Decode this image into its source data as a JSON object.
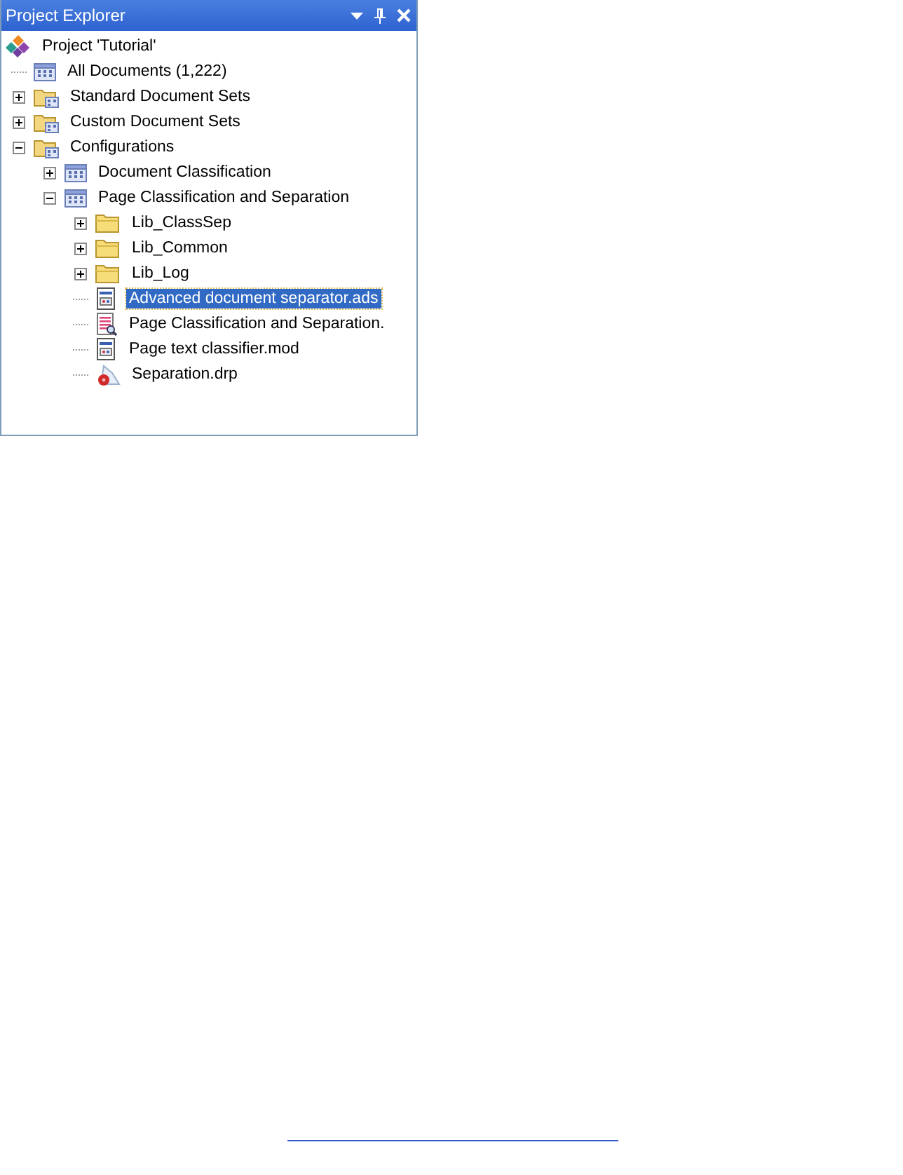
{
  "panel": {
    "title": "Project Explorer"
  },
  "tree": [
    {
      "label": "Project 'Tutorial'",
      "kind": "project",
      "selected": false,
      "children": [
        {
          "label": "All Documents  (1,222)",
          "kind": "docset",
          "selected": false
        },
        {
          "label": "Standard Document Sets",
          "kind": "folderset",
          "expanded": false,
          "selected": false
        },
        {
          "label": "Custom Document Sets",
          "kind": "folderset",
          "expanded": false,
          "selected": false
        },
        {
          "label": "Configurations",
          "kind": "folderset",
          "expanded": true,
          "selected": false,
          "children": [
            {
              "label": "Document Classification",
              "kind": "docset",
              "expanded": false,
              "selected": false
            },
            {
              "label": "Page Classification and Separation",
              "kind": "docset",
              "expanded": true,
              "selected": false,
              "children": [
                {
                  "label": "Lib_ClassSep",
                  "kind": "folder",
                  "expanded": false,
                  "selected": false
                },
                {
                  "label": "Lib_Common",
                  "kind": "folder",
                  "expanded": false,
                  "selected": false
                },
                {
                  "label": "Lib_Log",
                  "kind": "folder",
                  "expanded": false,
                  "selected": false
                },
                {
                  "label": "Advanced document separator.ads",
                  "kind": "module",
                  "selected": true
                },
                {
                  "label": "Page Classification and Separation.",
                  "kind": "report",
                  "selected": false
                },
                {
                  "label": "Page text classifier.mod",
                  "kind": "module",
                  "selected": false
                },
                {
                  "label": "Separation.drp",
                  "kind": "drp",
                  "selected": false
                }
              ]
            }
          ]
        }
      ]
    }
  ]
}
